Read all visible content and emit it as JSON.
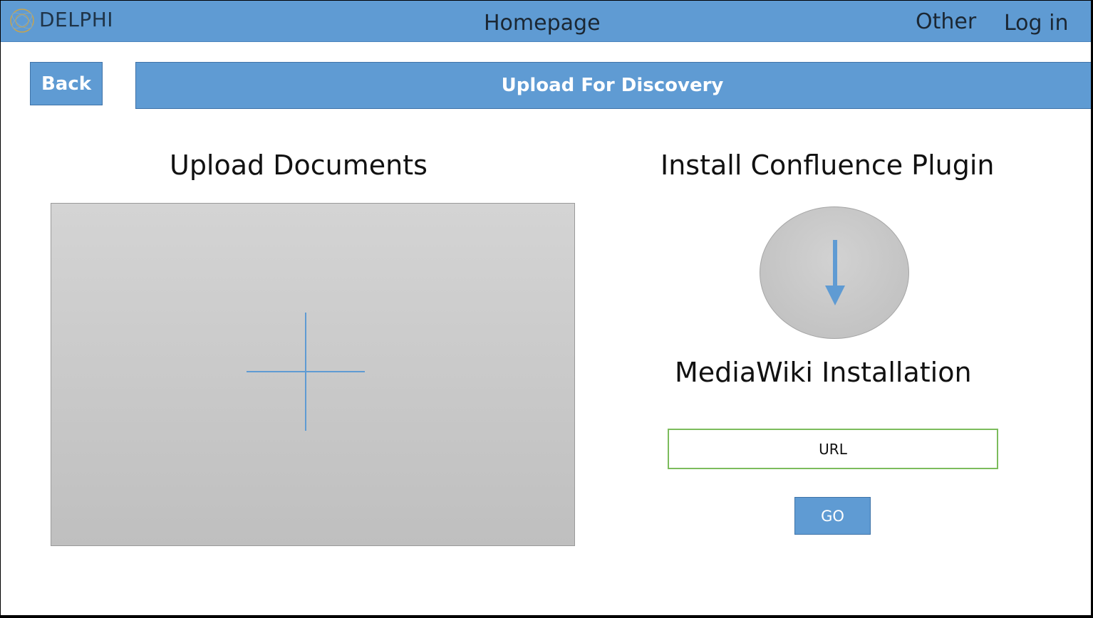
{
  "header": {
    "brand": "DELPHI",
    "nav": {
      "home": "Homepage",
      "other": "Other",
      "login": "Log in"
    }
  },
  "toolbar": {
    "back_label": "Back",
    "title": "Upload For Discovery"
  },
  "upload": {
    "heading": "Upload Documents",
    "dropzone_icon": "plus-icon"
  },
  "confluence": {
    "heading": "Install Confluence Plugin",
    "download_icon": "download-arrow-icon"
  },
  "mediawiki": {
    "heading": "MediaWiki Installation",
    "url_placeholder": "URL",
    "go_label": "GO"
  },
  "colors": {
    "accent": "#5f9bd3",
    "input_border": "#7cbc5c",
    "icon_stroke": "#5f9bd3"
  }
}
